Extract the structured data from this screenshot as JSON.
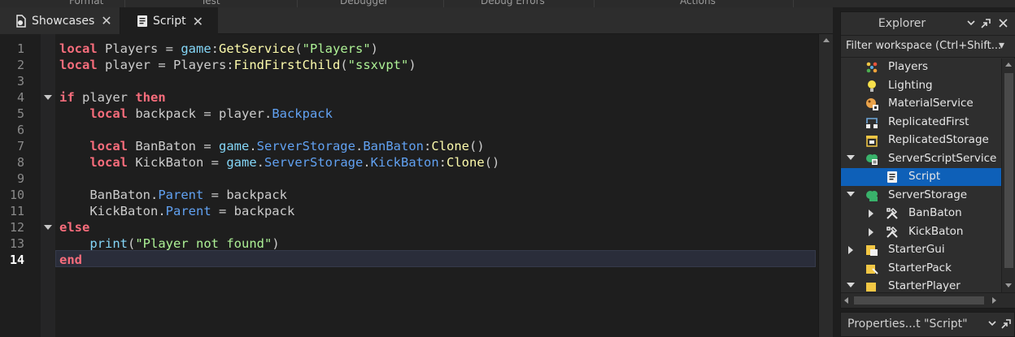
{
  "ribbon": {
    "items": [
      "Format",
      "Test",
      "Debugger",
      "Debug Errors",
      "Actions"
    ]
  },
  "tabs": [
    {
      "label": "Showcases",
      "icon": "showcase-icon",
      "close": "✕"
    },
    {
      "label": "Script",
      "icon": "script-icon",
      "close": "✕"
    }
  ],
  "editor": {
    "line_numbers": [
      "1",
      "2",
      "3",
      "4",
      "5",
      "6",
      "7",
      "8",
      "9",
      "10",
      "11",
      "12",
      "13",
      "14"
    ],
    "current_line": "14",
    "fold_lines": [
      "4",
      "12"
    ]
  },
  "explorer": {
    "title": "Explorer",
    "filter_placeholder": "Filter workspace (Ctrl+Shift...",
    "filter_more": "▾",
    "tree": [
      {
        "label": "Players",
        "icon": "players-icon",
        "expander": "none"
      },
      {
        "label": "Lighting",
        "icon": "lighting-icon",
        "expander": "none"
      },
      {
        "label": "MaterialService",
        "icon": "material-service-icon",
        "expander": "none"
      },
      {
        "label": "ReplicatedFirst",
        "icon": "replicated-first-icon",
        "expander": "none"
      },
      {
        "label": "ReplicatedStorage",
        "icon": "replicated-storage-icon",
        "expander": "none"
      },
      {
        "label": "ServerScriptService",
        "icon": "server-script-service-icon",
        "expander": "expanded"
      },
      {
        "label": "Script",
        "icon": "script-icon",
        "expander": "none",
        "selected": true
      },
      {
        "label": "ServerStorage",
        "icon": "server-storage-icon",
        "expander": "expanded"
      },
      {
        "label": "BanBaton",
        "icon": "tool-icon",
        "expander": "collapsed"
      },
      {
        "label": "KickBaton",
        "icon": "tool-icon",
        "expander": "collapsed"
      },
      {
        "label": "StarterGui",
        "icon": "starter-gui-icon",
        "expander": "collapsed"
      },
      {
        "label": "StarterPack",
        "icon": "starter-pack-icon",
        "expander": "none"
      },
      {
        "label": "StarterPlayer",
        "icon": "starter-player-icon",
        "expander": "expanded"
      }
    ]
  },
  "properties": {
    "title": "Properties...t \"Script\""
  },
  "colors": {
    "keyword": "#f86d7c",
    "global": "#84d6f7",
    "method": "#fdfbac",
    "string": "#adf195",
    "property": "#61a1f1",
    "selection": "#0e60b8"
  }
}
